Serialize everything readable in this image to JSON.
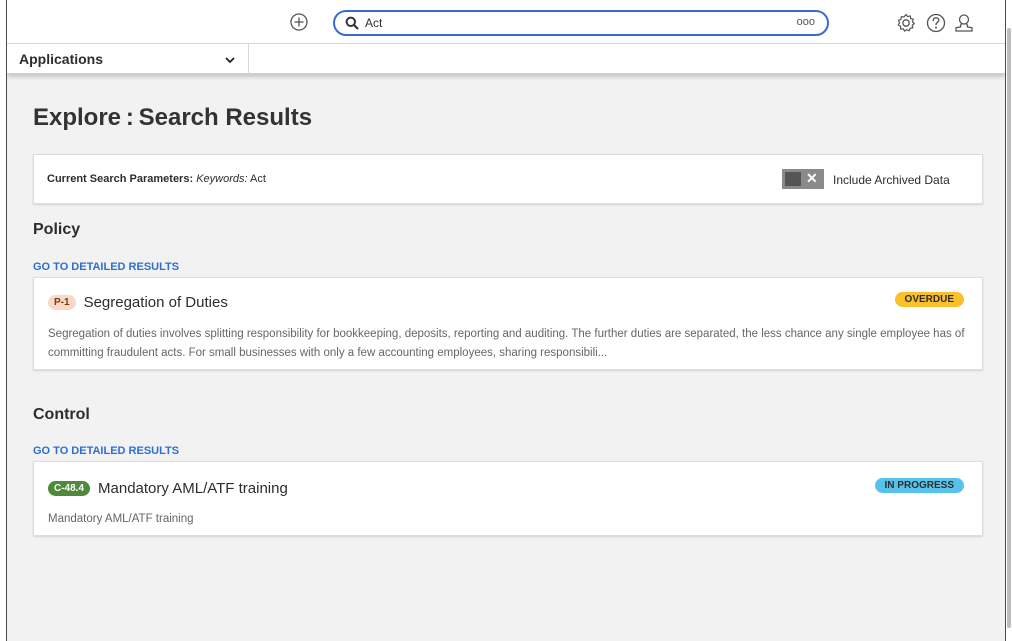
{
  "topbar": {
    "search_value": "Act",
    "more_label": "ooo"
  },
  "appbar": {
    "selected": "Applications"
  },
  "page": {
    "title": "Explore : Search Results"
  },
  "params": {
    "label": "Current Search Parameters:",
    "keywords_label": "Keywords:",
    "keywords_value": "Act",
    "archived_label": "Include Archived Data"
  },
  "sections": [
    {
      "title": "Policy",
      "link": "GO TO DETAILED RESULTS",
      "result": {
        "id": "P-1",
        "name": "Segregation of Duties",
        "status": "OVERDUE",
        "description": "Segregation of duties involves splitting responsibility for bookkeeping, deposits, reporting and auditing. The further duties are separated, the less chance any single employee has of committing fraudulent acts. For small businesses with only a few accounting employees, sharing responsibili..."
      }
    },
    {
      "title": "Control",
      "link": "GO TO DETAILED RESULTS",
      "result": {
        "id": "C-48.4",
        "name": "Mandatory AML/ATF training",
        "status": "IN PROGRESS",
        "description": "Mandatory AML/ATF training"
      }
    }
  ],
  "colors": {
    "accent": "#3a6bd1",
    "link": "#2f6fd0",
    "overdue": "#f9c02b",
    "in_progress": "#58c3ea"
  }
}
